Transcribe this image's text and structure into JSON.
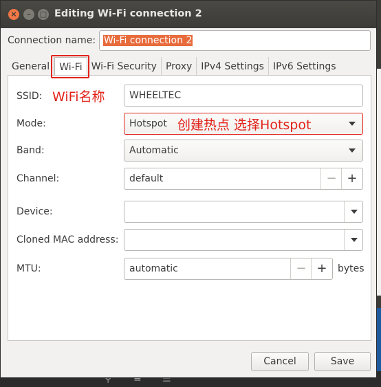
{
  "window": {
    "title": "Editing Wi-Fi connection 2"
  },
  "connection": {
    "label": "Connection name:",
    "value": "Wi-Fi connection 2"
  },
  "tabs": [
    {
      "label": "General"
    },
    {
      "label": "Wi-Fi"
    },
    {
      "label": "Wi-Fi Security"
    },
    {
      "label": "Proxy"
    },
    {
      "label": "IPv4 Settings"
    },
    {
      "label": "IPv6 Settings"
    }
  ],
  "fields": {
    "ssid": {
      "label": "SSID:",
      "value": "WHEELTEC"
    },
    "mode": {
      "label": "Mode:",
      "value": "Hotspot"
    },
    "band": {
      "label": "Band:",
      "value": "Automatic"
    },
    "channel": {
      "label": "Channel:",
      "value": "default"
    },
    "device": {
      "label": "Device:",
      "value": ""
    },
    "cloned_mac": {
      "label": "Cloned MAC address:",
      "value": ""
    },
    "mtu": {
      "label": "MTU:",
      "value": "automatic",
      "unit": "bytes"
    }
  },
  "annotations": {
    "wifi_name": "WiFi名称",
    "hotspot_hint": "创建热点 选择Hotspot"
  },
  "buttons": {
    "cancel": "Cancel",
    "save": "Save"
  },
  "colors": {
    "annotation": "#e2231a",
    "selection": "#e86b3c",
    "titlebar": "#3c3b37"
  }
}
